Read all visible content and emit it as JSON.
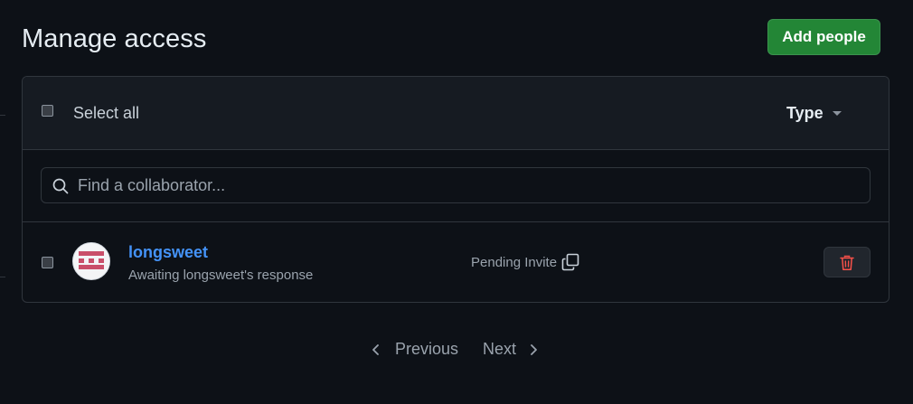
{
  "header": {
    "title": "Manage access",
    "add_button_label": "Add people"
  },
  "table": {
    "select_all_label": "Select all",
    "type_filter_label": "Type",
    "search_placeholder": "Find a collaborator...",
    "members": [
      {
        "username": "longsweet",
        "status_text": "Awaiting longsweet's response",
        "invite_state": "Pending Invite"
      }
    ]
  },
  "pagination": {
    "previous_label": "Previous",
    "next_label": "Next"
  },
  "colors": {
    "background": "#0d1117",
    "accent_green": "#238636",
    "link_blue": "#4493f8",
    "danger_red": "#f85149"
  },
  "icons": {
    "search": "search-icon",
    "copy": "copy-icon",
    "delete": "trash-icon",
    "caret": "caret-down-icon",
    "prev": "chevron-left-icon",
    "next": "chevron-right-icon"
  }
}
